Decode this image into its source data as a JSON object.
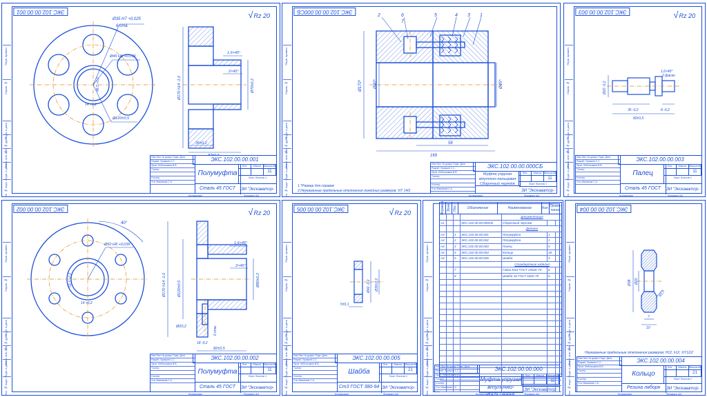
{
  "sheets": [
    {
      "id": "s1",
      "code_rot": "ЭКС.102.00.00.001",
      "roughness": "Rz 20",
      "code": "ЭКС.102.00.00.001",
      "title": "Полумуфта",
      "material": "Сталь 45 ГОСТ 1050-88",
      "org": "ЗИ \"Экскаватор-Сервис\"",
      "sheets_total": "11",
      "scale": "1:1",
      "copied": "Копировал",
      "format": "Формат А4"
    },
    {
      "id": "s2",
      "code_rot": "ЭКС.102.00.00.000СБ",
      "code": "ЭКС.102.00.00.000СБ",
      "title": "Муфта упругая втулочно-пальцевая Сборочный чертёж",
      "org": "ЗИ \"Экскаватор-Сервис\"",
      "sheets_total": "11",
      "scale": "1:1",
      "copied": "Копировал",
      "format": "Формат А4",
      "notes": [
        "1.*Размер для справок",
        "2.Неуказанные предельные отклонения линейных размеров: ±IT 14/2"
      ]
    },
    {
      "id": "s3",
      "code_rot": "ЭКС.102.00.00.003",
      "roughness": "Rz 20",
      "code": "ЭКС.102.00.00.003",
      "title": "Палец",
      "material": "Сталь 45 ГОСТ 1050-88",
      "org": "ЗИ \"Экскаватор-Сервис\"",
      "sheets_total": "11",
      "scale": "2:1",
      "copied": "Копировал",
      "format": "Формат А4"
    },
    {
      "id": "s4",
      "code_rot": "ЭКС.102.00.00.002",
      "roughness": "Rz 20",
      "code": "ЭКС.102.00.00.002",
      "title": "Полумуфта",
      "material": "Сталь 45 ГОСТ 1050-88",
      "org": "ЗИ \"Экскаватор-Сервис\"",
      "sheets_total": "11",
      "scale": "1:1",
      "copied": "Копировал",
      "format": "Формат А4"
    },
    {
      "id": "s5",
      "code_rot": "ЭКС.102.00.00.005",
      "roughness": "Rz 20",
      "code": "ЭКС.102.00.00.005",
      "title": "Шайба",
      "material": "Ст3 ГОСТ 380-94",
      "org": "ЗИ \"Экскаватор-Сервис\"",
      "sheets_total": "21",
      "scale": "2:1",
      "copied": "Копировал",
      "format": "Формат А4"
    },
    {
      "id": "s6",
      "code": "ЭКС.102.00.00.000",
      "title": "Муфта упругая втулочно-пальцевая",
      "org": "ЗИ \"Экскаватор-Сервис\"",
      "sheets_total": "11",
      "copied": "Копировал",
      "format": "Формат А4"
    },
    {
      "id": "s7",
      "code_rot": "ЭКС.102.00.00.004",
      "code": "ЭКС.102.00.00.004",
      "title": "Кольцо",
      "material": "Резина ляборя",
      "org": "ЗИ \"Экскаватор-Сервис\"",
      "sheets_total": "21",
      "scale": "2:1",
      "copied": "Копировал",
      "format": "Формат А4",
      "notes": [
        "Неуказанные предельные отклонения размеров: H12, h12, ±IT12/2"
      ]
    }
  ],
  "tb_grid": [
    "Изм Лист  № докум.  Подп. Дата",
    "Разраб.  Лукашев С.С.",
    "Пров.  Небольшина В.В.",
    "Т.контр.",
    "",
    "Н.контр.",
    "Утв.  Максимов С.А."
  ],
  "tb_lit_head": [
    "Лит.",
    "Масса",
    "Масштаб"
  ],
  "tb_sheet_row": "Лист  Листов 1",
  "spec": {
    "headers": [
      "Формат",
      "Зона",
      "Поз.",
      "Обозначение",
      "Наименование",
      "Кол.",
      "Приме- чание"
    ],
    "rows": [
      {
        "kind": "section",
        "name": "Документация"
      },
      {
        "kind": "item",
        "fmt": "А1",
        "pos": "",
        "code": "ЭКС.102.00.00.000СБ",
        "name": "Сборочный чертеж",
        "qty": ""
      },
      {
        "kind": "section",
        "name": "Детали"
      },
      {
        "kind": "item",
        "fmt": "А4",
        "pos": "1",
        "code": "ЭКС.102.00.00.001",
        "name": "Полумуфта",
        "qty": "1"
      },
      {
        "kind": "item",
        "fmt": "А4",
        "pos": "2",
        "code": "ЭКС.102.00.00.002",
        "name": "Полумуфта",
        "qty": "1"
      },
      {
        "kind": "item",
        "fmt": "А4",
        "pos": "3",
        "code": "ЭКС.102.00.00.003",
        "name": "Палец",
        "qty": "6"
      },
      {
        "kind": "item",
        "fmt": "А4",
        "pos": "4",
        "code": "ЭКС.102.00.00.004",
        "name": "Кольцо",
        "qty": "18"
      },
      {
        "kind": "item",
        "fmt": "А4",
        "pos": "5",
        "code": "ЭКС.102.00.00.005",
        "name": "Шайба",
        "qty": "3"
      },
      {
        "kind": "section",
        "name": "Стандартные изделия"
      },
      {
        "kind": "item",
        "fmt": "",
        "pos": "7",
        "code": "",
        "name": "Гайка М16 ГОСТ 15526-70",
        "qty": "6"
      },
      {
        "kind": "item",
        "fmt": "",
        "pos": "8",
        "code": "",
        "name": "Шайба 16 ГОСТ 6402-70",
        "qty": "6"
      }
    ]
  },
  "dims": {
    "s1": {
      "holes": "Ø35 Н7 +0,025",
      "holes_n": "6 отв.",
      "bore": "Ø45 Н8 +0,039",
      "key": "48,5 +0,2",
      "key_w": "14 +0,2",
      "pcd": "Ø120±0,5",
      "dia": "Ø170 h14 -1,0",
      "ch1": "1,6×45°",
      "ch2": "2×45°",
      "d70": "Ø70±0,2",
      "l35": "35±0,2",
      "l82": "82±0,5"
    },
    "s2": {
      "pos": [
        "2",
        "6",
        "7",
        "5",
        "4",
        "3",
        "1"
      ],
      "d170": "Ø170*",
      "d40": "Ø40*",
      "d45": "Ø45*",
      "l58": "58",
      "l169": "169"
    },
    "s3": {
      "ch": "1,6×45°",
      "faski": "2 фаски",
      "d20": "Ø20 -0,2",
      "l82": "82±0,5",
      "l35": "35 -0,2",
      "l31": "31 -0,2",
      "l8": "8 -0,2"
    },
    "s4": {
      "ang": "40°",
      "bore": "Ø50 Н8 +0,039",
      "key": "53,3 +0,2",
      "key_w": "14 +0,2",
      "dia": "Ø170 h14 -1,0",
      "d120": "Ø120±0,5",
      "ch1": "1,6×45°",
      "ch2": "2×45°",
      "d80": "Ø80±0,2",
      "d202": "Ø20,2",
      "holes": "6 отв.",
      "l18": "18 -0,2",
      "l82": "82±0,5"
    },
    "s5": {
      "d42": "Ø42 -0,2",
      "d30": "Ø30±0,2",
      "l5": "5±0,1"
    },
    "s7": {
      "d38": "Ø38",
      "d20": "Ø20",
      "r": "R2,5",
      "l7": "7",
      "l10": "10"
    }
  }
}
